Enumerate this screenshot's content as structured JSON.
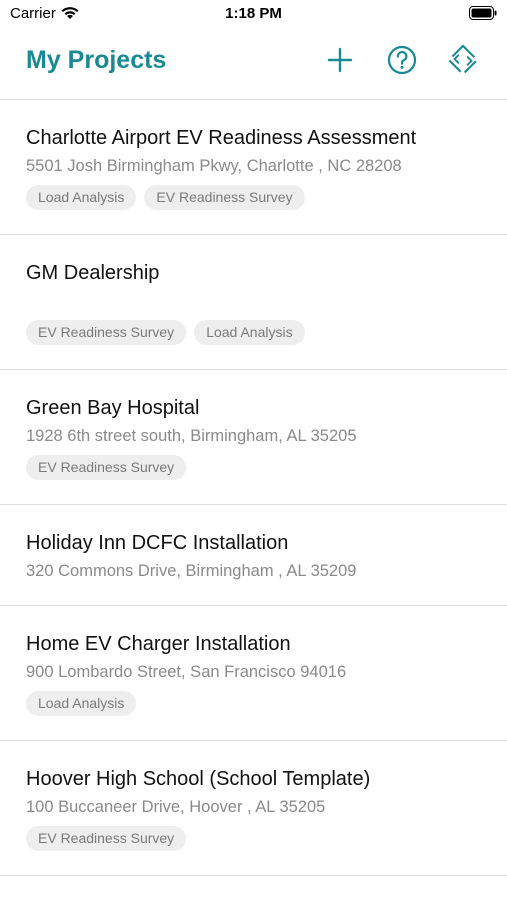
{
  "status": {
    "carrier": "Carrier",
    "time": "1:18 PM"
  },
  "header": {
    "title": "My Projects",
    "accent_color": "#1a8a92",
    "actions": [
      {
        "icon": "plus-icon"
      },
      {
        "icon": "help-circle-icon"
      },
      {
        "icon": "diamond-arrows-icon"
      }
    ]
  },
  "projects": [
    {
      "name": "Charlotte Airport EV Readiness Assessment",
      "address": "5501 Josh Birmingham Pkwy, Charlotte , NC 28208",
      "tags": [
        "Load Analysis",
        "EV Readiness Survey"
      ]
    },
    {
      "name": "GM Dealership",
      "address": "",
      "tags": [
        "EV Readiness Survey",
        "Load Analysis"
      ]
    },
    {
      "name": "Green Bay Hospital",
      "address": "1928 6th street south, Birmingham, AL 35205",
      "tags": [
        "EV Readiness Survey"
      ]
    },
    {
      "name": "Holiday Inn DCFC Installation",
      "address": "320 Commons Drive, Birmingham , AL 35209",
      "tags": []
    },
    {
      "name": "Home EV Charger Installation",
      "address": "900 Lombardo Street, San Francisco  94016",
      "tags": [
        "Load Analysis"
      ]
    },
    {
      "name": "Hoover High School (School Template)",
      "address": "100 Buccaneer Drive, Hoover , AL 35205",
      "tags": [
        "EV Readiness Survey"
      ]
    }
  ]
}
